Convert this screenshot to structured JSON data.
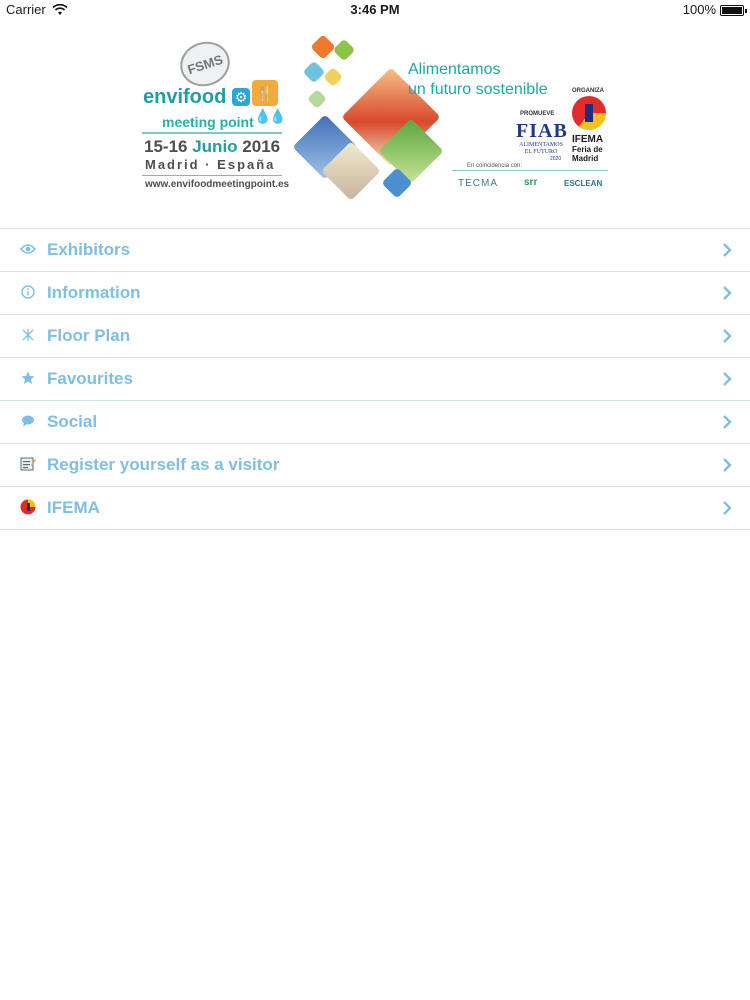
{
  "status_bar": {
    "carrier": "Carrier",
    "time": "3:46 PM",
    "battery": "100%"
  },
  "banner": {
    "badge": "FSMS",
    "brand_name": "envifood",
    "brand_sub": "meeting point",
    "dates_prefix": "15-16",
    "dates_month": "Junio",
    "dates_year": "2016",
    "city": "Madrid · España",
    "website": "www.envifoodmeetingpoint.es",
    "tagline_line1": "Alimentamos",
    "tagline_line2": "un futuro sostenible",
    "promueve_label": "PROMUEVE",
    "fiab_logo": "FIAB",
    "fiab_sub": "ALIMENTAMOS EL FUTURO",
    "fiab_year": "2020",
    "organiza_label": "ORGANIZA",
    "ifema_name": "IFEMA",
    "ifema_sub": "Feria de Madrid",
    "coincidencia": "En coincidencia con:",
    "partner_tecma": "TECMA",
    "partner_srr": "srr",
    "partner_clean": "ESCLEAN"
  },
  "menu": {
    "items": [
      {
        "label": "Exhibitors",
        "icon": "eye-icon"
      },
      {
        "label": "Information",
        "icon": "info-icon"
      },
      {
        "label": "Floor Plan",
        "icon": "map-icon"
      },
      {
        "label": "Favourites",
        "icon": "star-icon"
      },
      {
        "label": "Social",
        "icon": "chat-bubble-icon"
      },
      {
        "label": "Register yourself as a visitor",
        "icon": "register-form-icon"
      },
      {
        "label": "IFEMA",
        "icon": "ifema-logo-icon"
      }
    ]
  },
  "colors": {
    "menu_text": "#7fbfe3",
    "separator": "#cde3ef",
    "brand_teal": "#1f9ea4"
  }
}
